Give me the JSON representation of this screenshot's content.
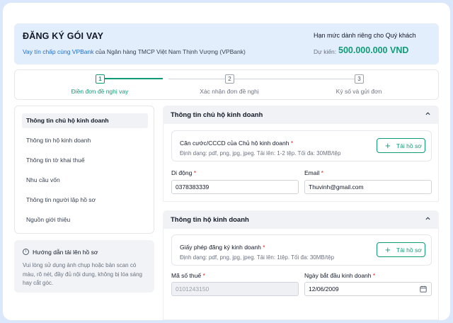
{
  "header": {
    "title": "ĐĂNG KÝ GÓI VAY",
    "subtitle_link": "Vay tín chấp cùng VPBank",
    "subtitle_rest": " của Ngân hàng TMCP Việt Nam Thịnh Vượng (VPBank)",
    "limit_title": "Hạn mức dành riêng cho Quý khách",
    "limit_label": "Dự kiến:",
    "limit_value": "500.000.000 VND"
  },
  "stepper": {
    "steps": [
      {
        "num": "1",
        "label": "Điền đơn đề nghị vay"
      },
      {
        "num": "2",
        "label": "Xác nhận đơn đề nghị"
      },
      {
        "num": "3",
        "label": "Ký số và gửi đơn"
      }
    ]
  },
  "sidebar": {
    "items": [
      {
        "label": "Thông tin chủ hộ kinh doanh"
      },
      {
        "label": "Thông tin hộ kinh doanh"
      },
      {
        "label": "Thông tin tờ khai thuế"
      },
      {
        "label": "Nhu cầu vốn"
      },
      {
        "label": "Thông tin người lập hồ sơ"
      },
      {
        "label": "Nguồn giới thiệu"
      }
    ]
  },
  "guide": {
    "icon": "info-icon",
    "title": "Hướng dẫn tải lên hồ sơ",
    "text": "Vui lòng sử dụng ảnh chụp hoặc bản scan có màu, rõ nét, đầy đủ nội dung, không bị lóa sáng hay cắt góc."
  },
  "section1": {
    "title": "Thông tin chủ hộ kinh doanh",
    "upload_title": "Căn cước/CCCD của Chủ hộ kinh doanh",
    "upload_hint": "Định dạng: pdf, png, jpg, jpeg. Tải lên: 1-2 tệp. Tối đa: 30MB/tệp",
    "upload_button": "Tải hồ sơ",
    "phone_label": "Di động",
    "phone_value": "0378383339",
    "email_label": "Email",
    "email_value": "Thuvinh@gmail.com"
  },
  "section2": {
    "title": "Thông tin hộ kinh doanh",
    "upload_title": "Giấy phép đăng ký kinh doanh",
    "upload_hint": "Định dạng: pdf, png, jpg, jpeg. Tải lên: 1tệp. Tối đa: 30MB/tệp",
    "upload_button": "Tải hồ sơ",
    "tax_label": "Mã số thuế",
    "tax_value": "0101243150",
    "date_label": "Ngày bắt đầu kinh doanh",
    "date_value": "12/06/2009"
  },
  "required_mark": "*",
  "colors": {
    "accent": "#0f9b76",
    "link": "#1d6fd1",
    "required": "#dc2626"
  }
}
